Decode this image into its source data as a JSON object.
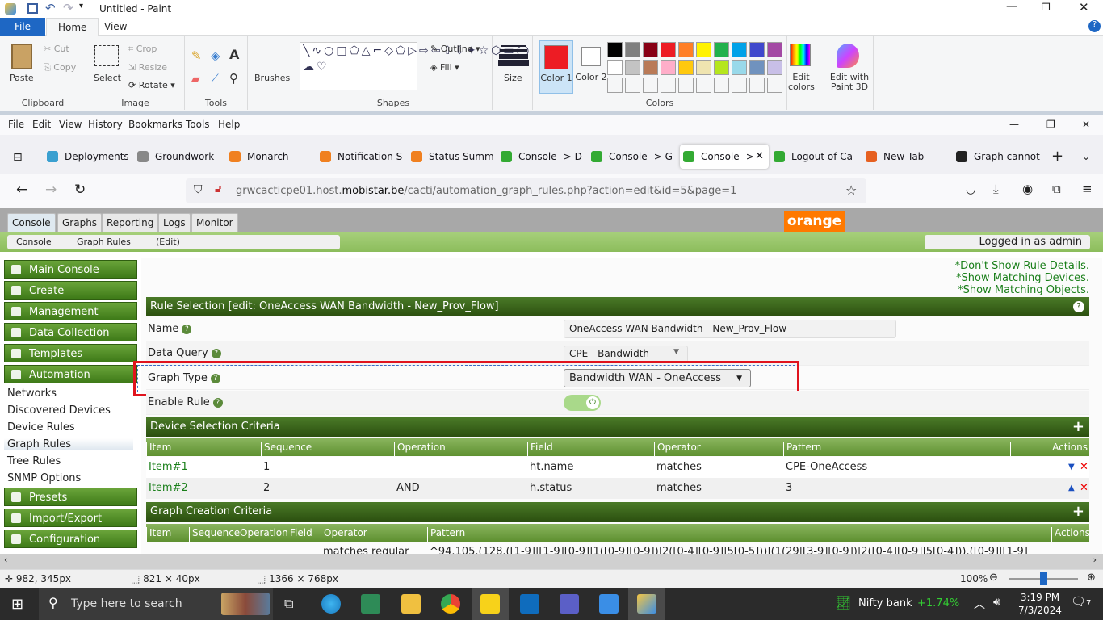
{
  "paint": {
    "title": "Untitled - Paint",
    "tabs": [
      "File",
      "Home",
      "View"
    ],
    "clipboard": {
      "paste": "Paste",
      "cut": "Cut",
      "copy": "Copy",
      "label": "Clipboard"
    },
    "image": {
      "select": "Select",
      "crop": "Crop",
      "resize": "Resize",
      "rotate": "Rotate",
      "label": "Image"
    },
    "tools_label": "Tools",
    "brushes": "Brushes",
    "shapes": {
      "outline": "Outline",
      "fill": "Fill",
      "label": "Shapes"
    },
    "size": "Size",
    "color1": "Color 1",
    "color2": "Color 2",
    "color1_value": "#ed1c24",
    "color2_value": "#ffffff",
    "palette": [
      [
        "#000000",
        "#7f7f7f",
        "#880015",
        "#ed1c24",
        "#ff7f27",
        "#fff200",
        "#22b14c",
        "#00a2e8",
        "#3f48cc",
        "#a349a4"
      ],
      [
        "#ffffff",
        "#c3c3c3",
        "#b97a57",
        "#ffaec9",
        "#ffc90e",
        "#efe4b0",
        "#b5e61d",
        "#99d9ea",
        "#7092be",
        "#c8bfe7"
      ]
    ],
    "edit_colors": "Edit colors",
    "paint3d": "Edit with Paint 3D",
    "colors_label": "Colors",
    "status": {
      "cursor": "982, 345px",
      "selection": "821 × 40px",
      "size": "1366 × 768px",
      "zoom": "100%"
    }
  },
  "firefox": {
    "menu": [
      "File",
      "Edit",
      "View",
      "History",
      "Bookmarks",
      "Tools",
      "Help"
    ],
    "tabs": [
      "Deployments",
      "Groundwork",
      "Monarch",
      "Notification S",
      "Status Summ",
      "Console -> D",
      "Console -> G",
      "Console -> ",
      "Logout of Ca",
      "New Tab",
      "Graph cannot"
    ],
    "active_tab": 7,
    "url_pre": "grwcacticpe01.host.",
    "url_domain": "mobistar.be",
    "url_post": "/cacti/automation_graph_rules.php?action=edit&id=5&page=1"
  },
  "cacti": {
    "tabs": [
      "Console",
      "Graphs",
      "Reporting",
      "Logs",
      "Monitor"
    ],
    "logo": "orange",
    "breadcrumb": [
      "Console",
      "Graph Rules",
      "(Edit)"
    ],
    "logged_in": "Logged in as admin",
    "sidebar": {
      "headers": [
        "Main Console",
        "Create",
        "Management",
        "Data Collection",
        "Templates",
        "Automation"
      ],
      "automation_items": [
        "Networks",
        "Discovered Devices",
        "Device Rules",
        "Graph Rules",
        "Tree Rules",
        "SNMP Options"
      ],
      "footer_headers": [
        "Presets",
        "Import/Export",
        "Configuration"
      ]
    },
    "links": [
      "*Don't Show Rule Details.",
      "*Show Matching Devices.",
      "*Show Matching Objects."
    ],
    "rule_header": "Rule Selection [edit: OneAccess WAN Bandwidth - New_Prov_Flow]",
    "fields": {
      "name_label": "Name",
      "name_value": "OneAccess WAN Bandwidth - New_Prov_Flow",
      "dq_label": "Data Query",
      "dq_value": "CPE - Bandwidth",
      "gt_label": "Graph Type",
      "gt_value": "Bandwidth WAN - OneAccess",
      "enable_label": "Enable Rule",
      "enable_value": true
    },
    "device_header": "Device Selection Criteria",
    "device_cols": [
      "Item",
      "Sequence",
      "Operation",
      "Field",
      "Operator",
      "Pattern",
      "Actions"
    ],
    "device_rows": [
      [
        "Item#1",
        "1",
        "",
        "ht.name",
        "matches",
        "CPE-OneAccess"
      ],
      [
        "Item#2",
        "2",
        "AND",
        "h.status",
        "matches",
        "3"
      ]
    ],
    "graph_header": "Graph Creation Criteria",
    "graph_cols": [
      "Item",
      "Sequence",
      "Operation",
      "Field",
      "Operator",
      "Pattern",
      "Actions"
    ],
    "graph_row": [
      "",
      "",
      "",
      "",
      "matches regular",
      "^94.105.(128.([1-9]|[1-9][0-9]|1([0-9][0-9])|2([0-4][0-9]|5[0-5]))|(1(29|[3-9][0-9])|2([0-4][0-9]|5[0-4])).([0-9]|[1-9]"
    ]
  },
  "taskbar": {
    "search": "Type here to search",
    "nifty": "Nifty bank",
    "nifty_change": "+1.74%",
    "time": "3:19 PM",
    "date": "7/3/2024",
    "notifications": "7"
  }
}
